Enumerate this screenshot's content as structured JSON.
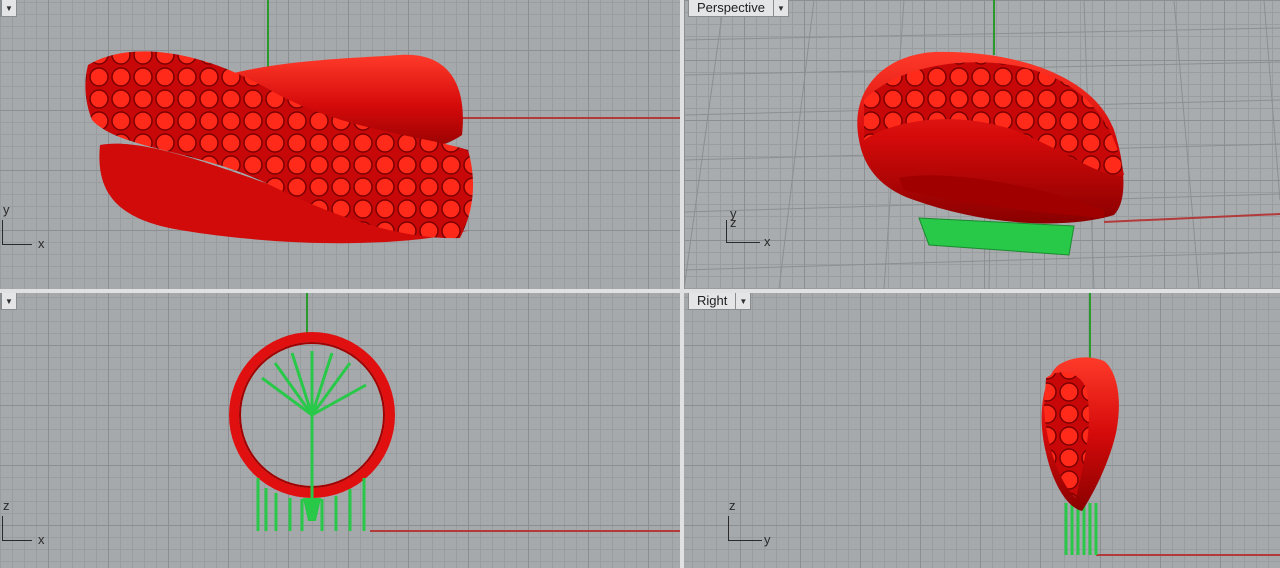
{
  "viewports": {
    "top": {
      "label": ""
    },
    "perspective": {
      "label": "Perspective"
    },
    "front": {
      "label": ""
    },
    "right": {
      "label": "Right"
    }
  },
  "axes": {
    "top": {
      "vertical": "y",
      "horizontal": "x"
    },
    "perspective": {
      "vertical": "y",
      "horizontal": "x",
      "depth": "z"
    },
    "front": {
      "vertical": "z",
      "horizontal": "x"
    },
    "right": {
      "vertical": "z",
      "horizontal": "y"
    }
  },
  "colors": {
    "ring": "#e01010",
    "support": "#22c040",
    "x_axis_line": "#b23a3a",
    "y_axis_line": "#2a9a2a"
  },
  "icons": [
    "viewport-menu-icon"
  ]
}
